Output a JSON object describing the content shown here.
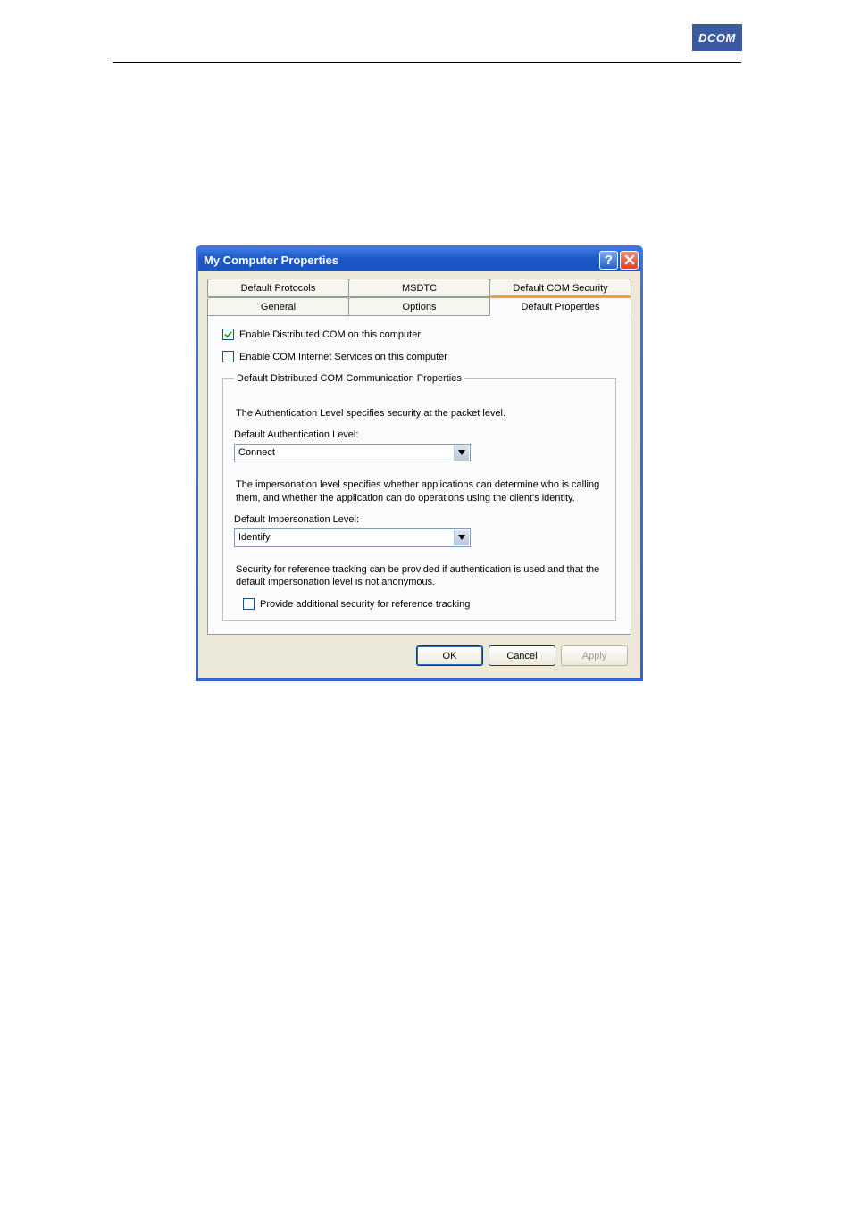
{
  "logo": "DCOM",
  "dialog": {
    "title": "My Computer Properties",
    "tabs_row1": [
      "Default Protocols",
      "MSDTC",
      "Default COM Security"
    ],
    "tabs_row2": [
      "General",
      "Options",
      "Default Properties"
    ],
    "active_tab": "Default Properties",
    "enable_dcom_label": "Enable Distributed COM on this computer",
    "enable_dcom_checked": true,
    "enable_cis_label": "Enable COM Internet Services on this computer",
    "enable_cis_checked": false,
    "group_legend": "Default Distributed COM Communication Properties",
    "auth_desc": "The Authentication Level specifies security at the packet level.",
    "auth_label": "Default Authentication Level:",
    "auth_value": "Connect",
    "impers_desc": "The impersonation level specifies whether applications can determine who is calling them, and whether the application can do operations using the client's identity.",
    "impers_label": "Default Impersonation Level:",
    "impers_value": "Identify",
    "tracking_desc": "Security for reference tracking can be provided if authentication is used and that the default impersonation level is not anonymous.",
    "tracking_check_label": "Provide additional security for reference tracking",
    "tracking_checked": false,
    "buttons": {
      "ok": "OK",
      "cancel": "Cancel",
      "apply": "Apply"
    }
  }
}
